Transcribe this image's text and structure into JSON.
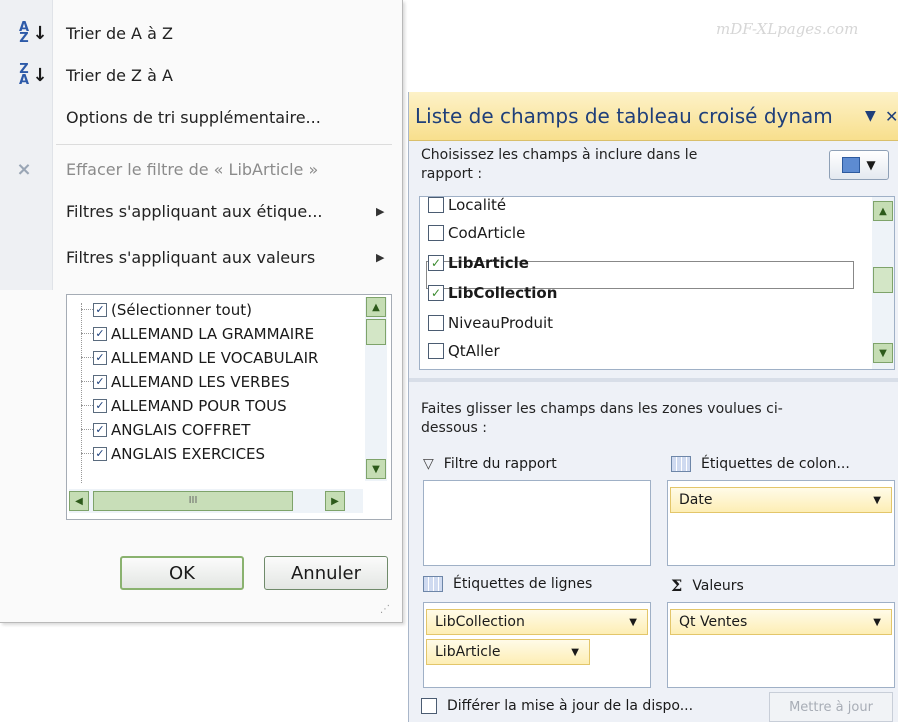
{
  "watermark": "mDF-XLpages.com",
  "menu": {
    "items": [
      {
        "icon": "sort-az-icon",
        "label": "Trier de A à Z"
      },
      {
        "icon": "sort-za-icon",
        "label": "Trier de Z à A"
      },
      {
        "label": "Options de tri supplémentaire..."
      },
      {
        "icon": "clear-filter-icon",
        "label": "Effacer le filtre de « LibArticle »",
        "disabled": true
      },
      {
        "label": "Filtres s'appliquant aux étique...",
        "submenu": true
      },
      {
        "label": "Filtres s'appliquant aux valeurs",
        "submenu": true
      }
    ],
    "filter_items": [
      "(Sélectionner tout)",
      "ALLEMAND LA GRAMMAIRE",
      "ALLEMAND LE VOCABULAIR",
      "ALLEMAND LES VERBES",
      "ALLEMAND POUR TOUS",
      "ANGLAIS COFFRET",
      "ANGLAIS EXERCICES"
    ],
    "hscroll_thumb": "III",
    "ok_label": "OK",
    "cancel_label": "Annuler"
  },
  "pane": {
    "title": "Liste de champs de tableau croisé dynam",
    "choose_label": "Choisissez les champs à inclure dans le rapport :",
    "fields": [
      {
        "label": "Localité",
        "checked": false,
        "bold": false
      },
      {
        "label": "CodArticle",
        "checked": false,
        "bold": false
      },
      {
        "label": "LibArticle",
        "checked": true,
        "bold": true
      },
      {
        "label": "LibCollection",
        "checked": true,
        "bold": true
      },
      {
        "label": "NiveauProduit",
        "checked": false,
        "bold": false
      },
      {
        "label": "QtAller",
        "checked": false,
        "bold": false
      }
    ],
    "drag_label": "Faites glisser les champs dans les zones voulues ci-dessous :",
    "zones": {
      "filter_label": "Filtre du rapport",
      "columns_label": "Étiquettes de colon...",
      "rows_label": "Étiquettes de lignes",
      "values_label": "Valeurs",
      "columns_items": [
        "Date"
      ],
      "rows_items": [
        "LibCollection",
        "LibArticle"
      ],
      "values_items": [
        "Qt Ventes"
      ]
    },
    "defer_label": "Différer la mise à jour de la dispo...",
    "update_label": "Mettre à jour"
  }
}
